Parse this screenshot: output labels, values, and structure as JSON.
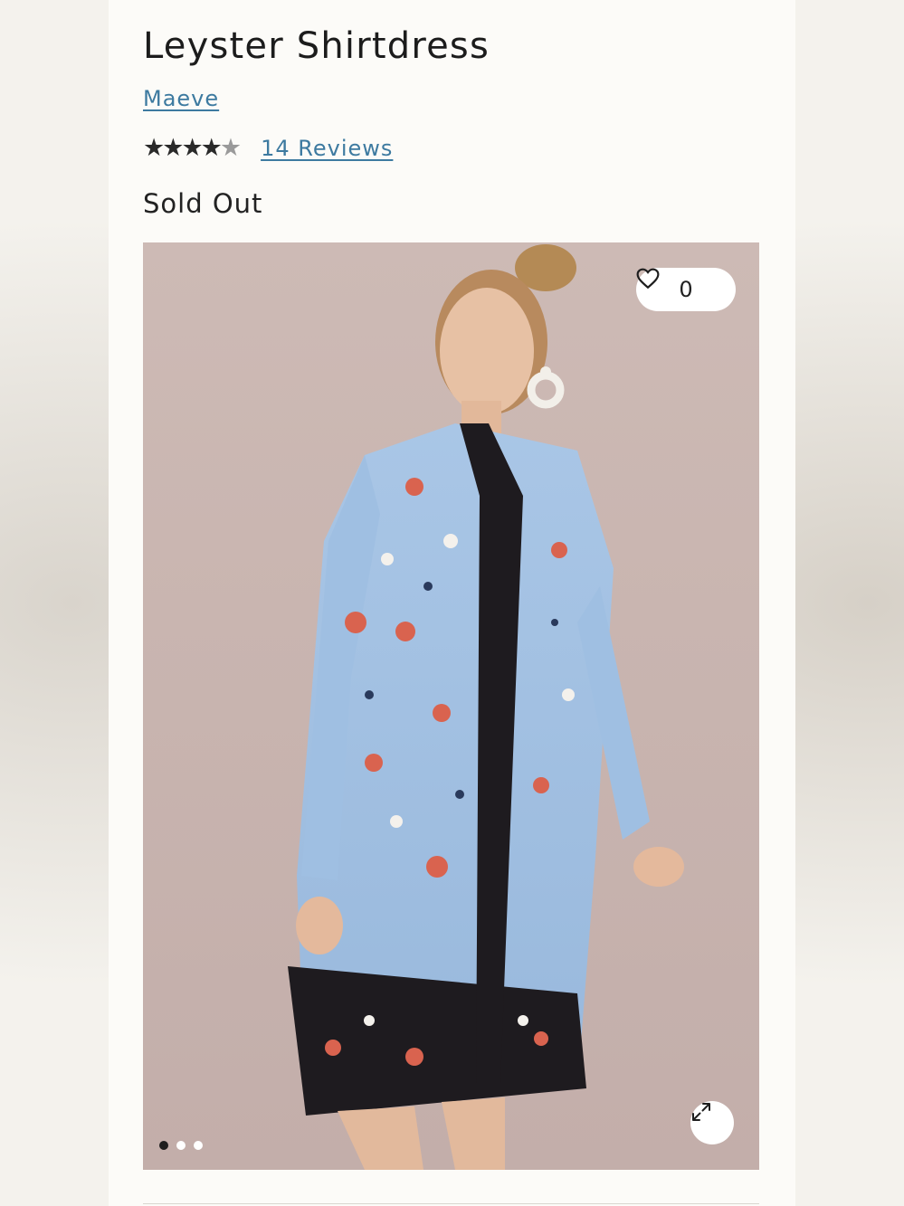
{
  "product": {
    "title": "Leyster Shirtdress",
    "brand": "Maeve",
    "rating": 4,
    "rating_max": 5,
    "reviews_label": "14 Reviews",
    "status": "Sold Out"
  },
  "gallery": {
    "like_count": "0",
    "slides": 3,
    "active_slide": 1,
    "icons": {
      "like": "heart-icon",
      "expand": "expand-icon"
    }
  },
  "colors": {
    "link": "#3d7aa0",
    "text": "#1c1c1c",
    "background": "#fcfbf8"
  }
}
